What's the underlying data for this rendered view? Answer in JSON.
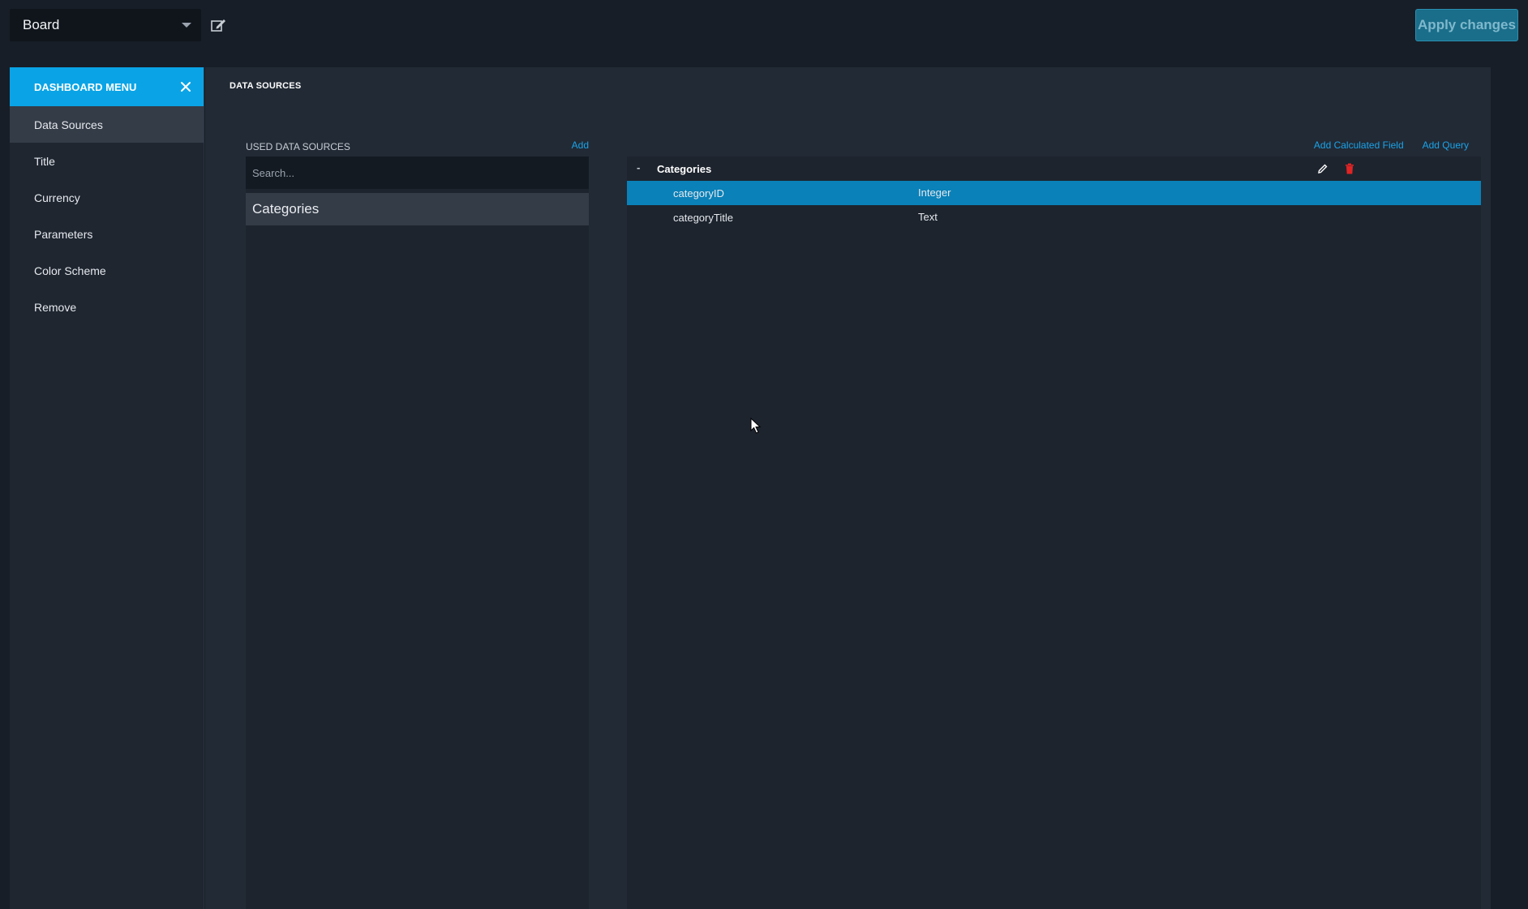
{
  "topbar": {
    "board_name": "Board",
    "apply_label": "Apply changes"
  },
  "sidebar": {
    "title": "DASHBOARD MENU",
    "items": [
      {
        "label": "Data Sources",
        "active": true
      },
      {
        "label": "Title"
      },
      {
        "label": "Currency"
      },
      {
        "label": "Parameters"
      },
      {
        "label": "Color Scheme"
      },
      {
        "label": "Remove"
      }
    ]
  },
  "main": {
    "title": "DATA SOURCES",
    "used": {
      "label": "USED DATA SOURCES",
      "add_label": "Add",
      "search_placeholder": "Search...",
      "items": [
        "Categories"
      ]
    },
    "fields": {
      "add_calculated_label": "Add Calculated Field",
      "add_query_label": "Add Query",
      "group": {
        "toggle": "-",
        "name": "Categories"
      },
      "rows": [
        {
          "name": "categoryID",
          "type": "Integer",
          "selected": true
        },
        {
          "name": "categoryTitle",
          "type": "Text"
        }
      ]
    }
  },
  "colors": {
    "accent": "#0aa4e6",
    "link": "#1aa3e8",
    "selected_row": "#0a81b8",
    "delete": "#e02424"
  }
}
